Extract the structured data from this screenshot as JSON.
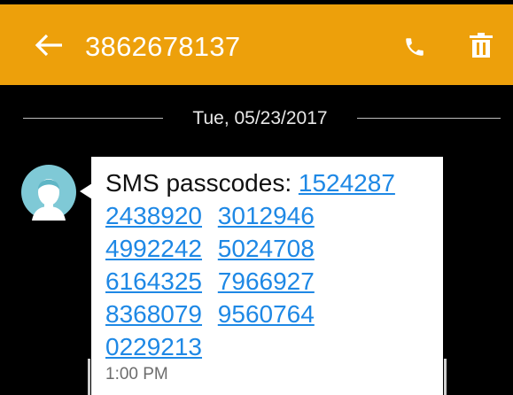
{
  "header": {
    "title": "3862678137",
    "back_icon": "arrow-left-icon",
    "call_icon": "phone-icon",
    "delete_icon": "trash-icon",
    "color": "#EDA00B"
  },
  "conversation": {
    "date": "Tue, 05/23/2017",
    "message": {
      "prefix": "SMS passcodes:",
      "codes": [
        "1524287",
        "2438920",
        "3012946",
        "4992242",
        "5024708",
        "6164325",
        "7966927",
        "8368079",
        "9560764",
        "0229213"
      ],
      "time": "1:00 PM",
      "link_color": "#1E88E5"
    }
  }
}
